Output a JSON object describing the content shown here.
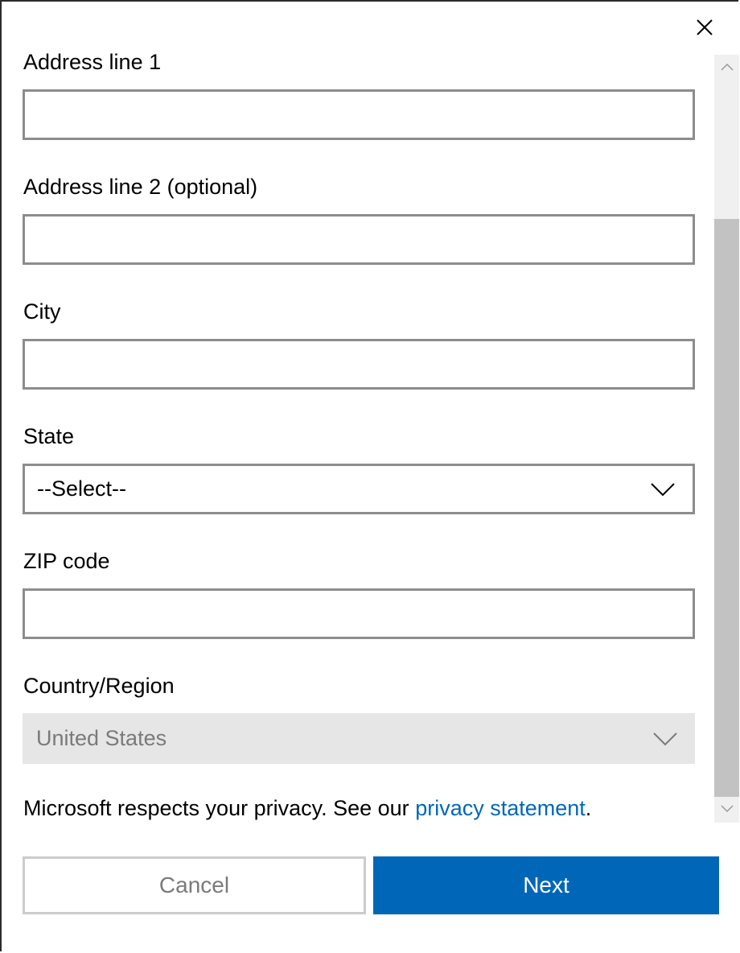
{
  "dialog": {
    "close_icon": "close-icon"
  },
  "form": {
    "address1": {
      "label": "Address line 1",
      "value": ""
    },
    "address2": {
      "label": "Address line 2 (optional)",
      "value": ""
    },
    "city": {
      "label": "City",
      "value": ""
    },
    "state": {
      "label": "State",
      "selected": "--Select--",
      "icon": "chevron-down-icon"
    },
    "zip": {
      "label": "ZIP code",
      "value": ""
    },
    "country": {
      "label": "Country/Region",
      "selected": "United States",
      "disabled": true,
      "icon": "chevron-down-icon"
    }
  },
  "privacy": {
    "text": "Microsoft respects your privacy. See our ",
    "link": "privacy statement",
    "suffix": "."
  },
  "buttons": {
    "cancel": "Cancel",
    "next": "Next"
  },
  "colors": {
    "accent": "#0067b8",
    "field_border": "#8d8d8d",
    "disabled_bg": "#e6e6e6"
  }
}
